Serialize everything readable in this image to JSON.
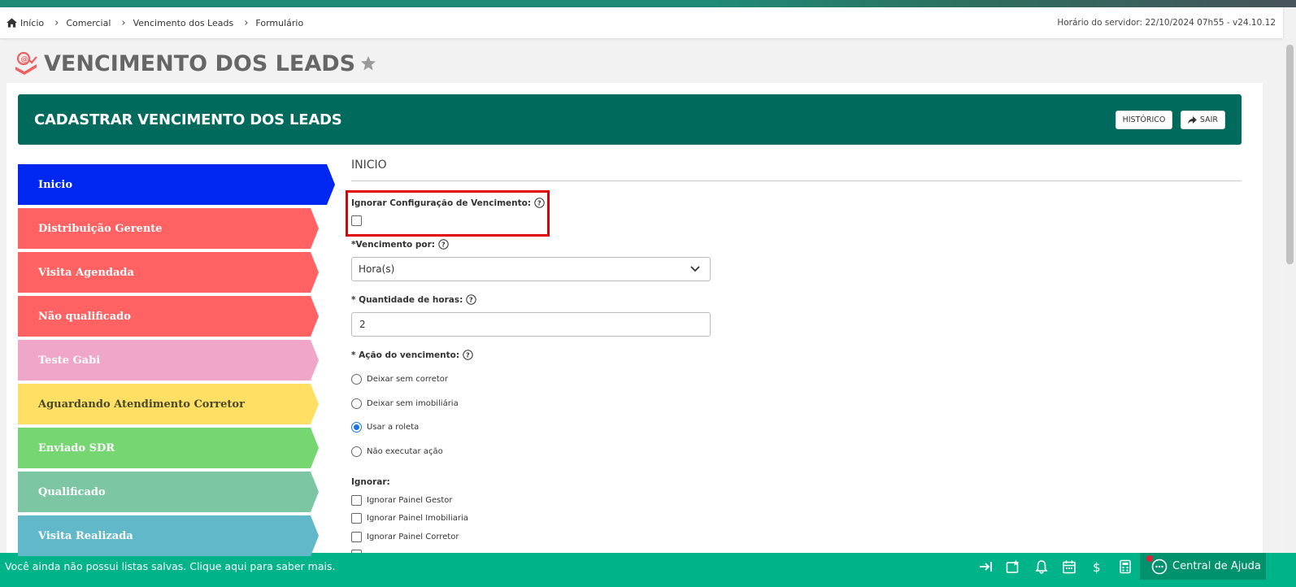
{
  "breadcrumb": {
    "items": [
      "Início",
      "Comercial",
      "Vencimento dos Leads",
      "Formulário"
    ],
    "server_time": "Horário do servidor: 22/10/2024 07h55 - v24.10.12"
  },
  "page": {
    "title": "VENCIMENTO DOS LEADS"
  },
  "header": {
    "title": "CADASTRAR VENCIMENTO DOS LEADS",
    "historico_label": "HISTÓRICO",
    "sair_label": "SAIR"
  },
  "steps": [
    {
      "label": "Inicio",
      "color": "#0027f0"
    },
    {
      "label": "Distribuição Gerente",
      "color": "#ff6262"
    },
    {
      "label": "Visita Agendada",
      "color": "#ff6262"
    },
    {
      "label": "Não qualificado",
      "color": "#ff6262"
    },
    {
      "label": "Teste Gabi",
      "color": "#f0a6c8"
    },
    {
      "label": "Aguardando Atendimento Corretor",
      "color": "#ffe065"
    },
    {
      "label": "Enviado SDR",
      "color": "#76d772"
    },
    {
      "label": "Qualificado",
      "color": "#7cc6a3"
    },
    {
      "label": "Visita Realizada",
      "color": "#61b8c9"
    }
  ],
  "form": {
    "section_title": "INICIO",
    "ignore_config_label": "Ignorar Configuração de Vencimento:",
    "vencimento_por_label": "*Vencimento por:",
    "vencimento_por_value": "Hora(s)",
    "quantidade_label": "* Quantidade de horas:",
    "quantidade_value": "2",
    "acao_label": "* Ação do vencimento:",
    "acao_options": [
      {
        "label": "Deixar sem corretor",
        "checked": false
      },
      {
        "label": "Deixar sem imobiliária",
        "checked": false
      },
      {
        "label": "Usar a roleta",
        "checked": true
      },
      {
        "label": "Não executar ação",
        "checked": false
      }
    ],
    "ignorar_label": "Ignorar:",
    "ignorar_options": [
      "Ignorar Painel Gestor",
      "Ignorar Painel Imobiliaria",
      "Ignorar Painel Corretor"
    ]
  },
  "footer": {
    "message": "Você ainda não possui listas salvas. Clique aqui para saber mais.",
    "help_center_label": "Central de Ajuda",
    "icons": [
      "collapse-arrow-icon",
      "favorites-icon",
      "bell-icon",
      "calendar-icon",
      "dollar-icon",
      "calculator-icon"
    ]
  }
}
